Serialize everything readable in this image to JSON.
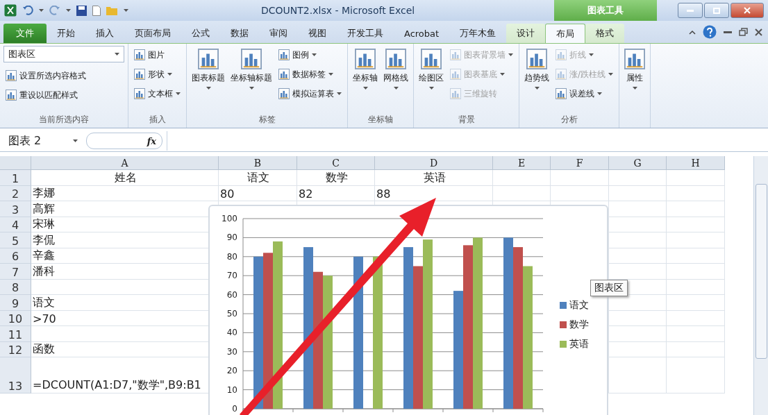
{
  "window": {
    "title": "DCOUNT2.xlsx  -  Microsoft Excel",
    "context_tab": "图表工具"
  },
  "tabs": [
    {
      "label": "文件",
      "kind": "file",
      "selected": false
    },
    {
      "label": "开始",
      "kind": "tab",
      "selected": false
    },
    {
      "label": "插入",
      "kind": "tab",
      "selected": false
    },
    {
      "label": "页面布局",
      "kind": "tab",
      "selected": false
    },
    {
      "label": "公式",
      "kind": "tab",
      "selected": false
    },
    {
      "label": "数据",
      "kind": "tab",
      "selected": false
    },
    {
      "label": "审阅",
      "kind": "tab",
      "selected": false
    },
    {
      "label": "视图",
      "kind": "tab",
      "selected": false
    },
    {
      "label": "开发工具",
      "kind": "tab",
      "selected": false
    },
    {
      "label": "Acrobat",
      "kind": "tab",
      "selected": false
    },
    {
      "label": "万年木鱼",
      "kind": "tab",
      "selected": false
    },
    {
      "label": "设计",
      "kind": "context",
      "selected": false
    },
    {
      "label": "布局",
      "kind": "context",
      "selected": true
    },
    {
      "label": "格式",
      "kind": "context",
      "selected": false
    }
  ],
  "ribbon": [
    {
      "label": "当前所选内容",
      "items": [
        {
          "kind": "dropdown",
          "label": "图表区",
          "menu": true,
          "disabled": false
        },
        {
          "kind": "small",
          "label": "设置所选内容格式",
          "menu": false,
          "disabled": false
        },
        {
          "kind": "small",
          "label": "重设以匹配样式",
          "menu": false,
          "disabled": false
        }
      ]
    },
    {
      "label": "插入",
      "items": [
        {
          "kind": "small",
          "label": "图片",
          "menu": false,
          "disabled": false
        },
        {
          "kind": "small",
          "label": "形状",
          "menu": true,
          "disabled": false
        },
        {
          "kind": "small",
          "label": "文本框",
          "menu": true,
          "disabled": false
        }
      ]
    },
    {
      "label": "标签",
      "items": [
        {
          "kind": "large",
          "label": "图表标题",
          "menu": true,
          "disabled": false
        },
        {
          "kind": "large",
          "label": "坐标轴标题",
          "menu": true,
          "disabled": false
        },
        {
          "kind": "small",
          "label": "图例",
          "menu": true,
          "disabled": false
        },
        {
          "kind": "small",
          "label": "数据标签",
          "menu": true,
          "disabled": false
        },
        {
          "kind": "small",
          "label": "模拟运算表",
          "menu": true,
          "disabled": false
        }
      ]
    },
    {
      "label": "坐标轴",
      "items": [
        {
          "kind": "large",
          "label": "坐标轴",
          "menu": true,
          "disabled": false
        },
        {
          "kind": "large",
          "label": "网格线",
          "menu": true,
          "disabled": false
        }
      ]
    },
    {
      "label": "背景",
      "items": [
        {
          "kind": "large",
          "label": "绘图区",
          "menu": true,
          "disabled": false
        },
        {
          "kind": "small",
          "label": "图表背景墙",
          "menu": true,
          "disabled": true
        },
        {
          "kind": "small",
          "label": "图表基底",
          "menu": true,
          "disabled": true
        },
        {
          "kind": "small",
          "label": "三维旋转",
          "menu": false,
          "disabled": true
        }
      ]
    },
    {
      "label": "分析",
      "items": [
        {
          "kind": "large",
          "label": "趋势线",
          "menu": true,
          "disabled": false
        },
        {
          "kind": "small",
          "label": "折线",
          "menu": true,
          "disabled": true
        },
        {
          "kind": "small",
          "label": "涨/跌柱线",
          "menu": true,
          "disabled": true
        },
        {
          "kind": "small",
          "label": "误差线",
          "menu": true,
          "disabled": false
        }
      ]
    },
    {
      "items": [
        {
          "kind": "large",
          "label": "属性",
          "menu": true,
          "disabled": false
        }
      ]
    }
  ],
  "formula_bar": {
    "name_box": "图表 2",
    "fx": "fx"
  },
  "sheet": {
    "columns": [
      "A",
      "B",
      "C",
      "D",
      "E",
      "F",
      "G",
      "H"
    ],
    "rows": [
      {
        "number": "1",
        "cells": [
          "姓名",
          "语文",
          "数学",
          "英语"
        ]
      },
      {
        "number": "2",
        "cells": [
          "李娜",
          "80",
          "82",
          "88"
        ]
      },
      {
        "number": "3",
        "cells": [
          "高辉"
        ]
      },
      {
        "number": "4",
        "cells": [
          "宋琳"
        ]
      },
      {
        "number": "5",
        "cells": [
          "李侃"
        ]
      },
      {
        "number": "6",
        "cells": [
          "辛鑫"
        ]
      },
      {
        "number": "7",
        "cells": [
          "潘科"
        ]
      },
      {
        "number": "8",
        "cells": []
      },
      {
        "number": "9",
        "cells": [
          "语文"
        ]
      },
      {
        "number": "10",
        "cells": [
          ">70"
        ]
      },
      {
        "number": "11",
        "cells": []
      },
      {
        "number": "12",
        "cells": [
          "函数"
        ]
      },
      {
        "number": "13",
        "cells": [
          "=DCOUNT(A1:D7,\"数学\",B9:B1"
        ]
      }
    ]
  },
  "chart": {
    "tooltip": "图表区",
    "chart_data": {
      "type": "bar",
      "grid": true,
      "ylim": [
        0,
        100
      ],
      "yticks": [
        0,
        10,
        20,
        30,
        40,
        50,
        60,
        70,
        80,
        90,
        100
      ],
      "series": [
        {
          "name": "语文",
          "color": "#4f81bd",
          "values": [
            80,
            85,
            80,
            85,
            62,
            90
          ]
        },
        {
          "name": "数学",
          "color": "#c0504d",
          "values": [
            82,
            72,
            null,
            75,
            86,
            85
          ]
        },
        {
          "name": "英语",
          "color": "#9bbb59",
          "values": [
            88,
            70,
            80,
            89,
            90,
            75
          ]
        }
      ]
    }
  }
}
